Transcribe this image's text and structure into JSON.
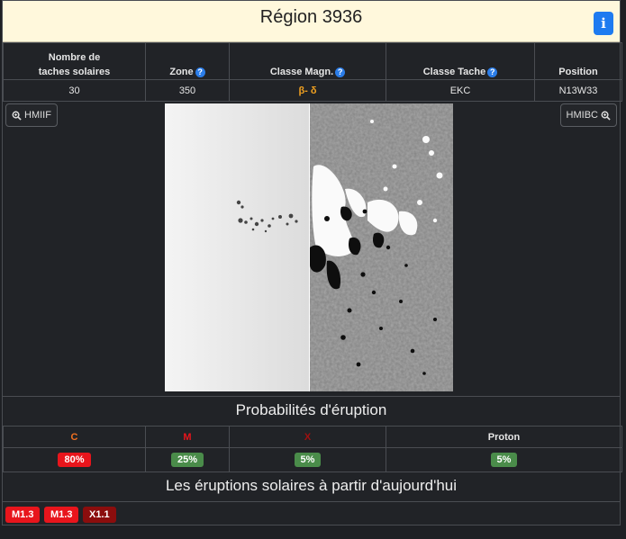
{
  "region": {
    "title": "Région 3936",
    "info_label": "i"
  },
  "table": {
    "headers": {
      "sunspots": "Nombre de\ntaches solaires",
      "zone": "Zone",
      "mag_class": "Classe Magn.",
      "spot_class": "Classe Tache",
      "position": "Position"
    },
    "values": {
      "sunspots": "30",
      "zone": "350",
      "mag_class": "β- δ",
      "spot_class": "EKC",
      "position": "N13W33"
    },
    "help_icon": "?"
  },
  "images": {
    "left_button": "HMIIF",
    "right_button": "HMIBC"
  },
  "probabilities": {
    "title": "Probabilités d'éruption",
    "columns": [
      {
        "label": "C",
        "value": "80%",
        "label_color": "#f07020",
        "badge_color": "#e8151c"
      },
      {
        "label": "M",
        "value": "25%",
        "label_color": "#e8151c",
        "badge_color": "#4a8c4a"
      },
      {
        "label": "X",
        "value": "5%",
        "label_color": "#a01010",
        "badge_color": "#4a8c4a"
      },
      {
        "label": "Proton",
        "value": "5%",
        "label_color": "#e6e6e6",
        "badge_color": "#4a8c4a"
      }
    ]
  },
  "flares": {
    "title": "Les éruptions solaires à partir d'aujourd'hui",
    "items": [
      {
        "label": "M1.3",
        "color": "#e8151c"
      },
      {
        "label": "M1.3",
        "color": "#e8151c"
      },
      {
        "label": "X1.1",
        "color": "#8b0d0d"
      }
    ]
  },
  "icons": {
    "info": "info-icon",
    "help": "question-circle-icon",
    "zoom": "magnifier-plus-icon"
  }
}
